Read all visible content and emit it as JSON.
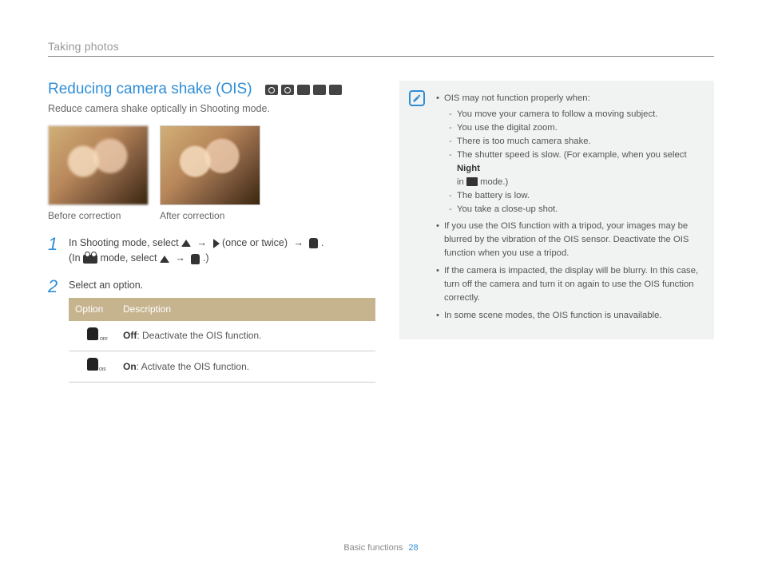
{
  "header": {
    "breadcrumb": "Taking photos"
  },
  "section": {
    "title": "Reducing camera shake (OIS)",
    "subtitle": "Reduce camera shake optically in Shooting mode."
  },
  "photos": {
    "before_caption": "Before correction",
    "after_caption": "After correction"
  },
  "steps": {
    "s1": {
      "num": "1",
      "text_a": "In Shooting mode, select ",
      "text_b": " (once or twice) ",
      "text_c": ".",
      "line2_a": "(In ",
      "line2_b": " mode, select ",
      "line2_c": ".)"
    },
    "s2": {
      "num": "2",
      "text": "Select an option."
    }
  },
  "table": {
    "h1": "Option",
    "h2": "Description",
    "rows": [
      {
        "label_bold": "Off",
        "label_rest": ": Deactivate the OIS function."
      },
      {
        "label_bold": "On",
        "label_rest": ": Activate the OIS function."
      }
    ]
  },
  "notes": {
    "intro": "OIS may not function properly when:",
    "sub": [
      "You move your camera to follow a moving subject.",
      "You use the digital zoom.",
      "There is too much camera shake.",
      "The shutter speed is slow. (For example, when you select ",
      " mode.)",
      "The battery is low.",
      "You take a close-up shot."
    ],
    "night_word": "Night",
    "in_word": "in ",
    "b2": "If you use the OIS function with a tripod, your images may be blurred by the vibration of the OIS sensor. Deactivate the OIS function when you use a tripod.",
    "b3": "If the camera is impacted, the display will be blurry. In this case, turn off the camera and turn it on again to use the OIS function correctly.",
    "b4": "In some scene modes, the OIS function is unavailable."
  },
  "footer": {
    "section": "Basic functions",
    "page": "28"
  },
  "arrows": {
    "r": "→"
  }
}
